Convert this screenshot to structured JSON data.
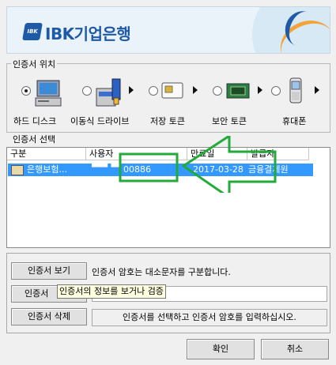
{
  "banner": {
    "brand": "IBK기업은행",
    "mark": "IBK"
  },
  "location": {
    "group_label": "인증서 위치",
    "items": [
      {
        "label": "하드 디스크",
        "selected": true,
        "icon": "computer-icon"
      },
      {
        "label": "이동식 드라이브",
        "selected": false,
        "icon": "removable-drive-icon"
      },
      {
        "label": "저장 토큰",
        "selected": false,
        "icon": "storage-token-icon"
      },
      {
        "label": "보안 토큰",
        "selected": false,
        "icon": "security-token-icon"
      },
      {
        "label": "휴대폰",
        "selected": false,
        "icon": "mobile-phone-icon"
      }
    ]
  },
  "cert_select": {
    "group_label": "인증서 선택",
    "columns": [
      "구분",
      "사용자",
      "만료일",
      "발급자"
    ],
    "rows": [
      {
        "type": "은행보험...",
        "user": "00886",
        "expiry": "2017-03-28",
        "issuer": "금융결제원"
      }
    ]
  },
  "buttons": {
    "view_cert": "인증서 보기",
    "second": "인증서",
    "delete_cert": "인증서 삭제",
    "ok": "확인",
    "cancel": "취소"
  },
  "password": {
    "hint": "인증서 암호는 대소문자를 구분합니다.",
    "value": ""
  },
  "tooltip": "인증서의 정보를 보거나 검증",
  "status_text": "인증서를 선택하고 인증서 암호를 입력하십시오.",
  "colors": {
    "accent": "#1f5aa6",
    "selection": "#3399ff",
    "annotation": "#22aa3a"
  }
}
